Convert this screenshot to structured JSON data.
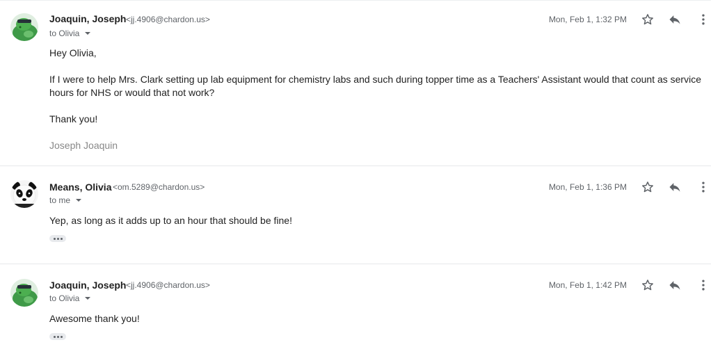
{
  "messages": [
    {
      "sender": "Joaquin, Joseph",
      "email": "<jj.4906@chardon.us>",
      "recipient": "to Olivia",
      "date": "Mon, Feb 1, 1:32 PM",
      "avatar_icon": "turtle-avatar-icon",
      "body": {
        "greeting": "Hey Olivia,",
        "paragraph": "If I were to help Mrs. Clark setting up lab equipment for chemistry labs and such during topper time as a Teachers' Assistant would that count as service hours for NHS or would that not work?",
        "closing": "Thank you!",
        "signature": "Joseph Joaquin"
      }
    },
    {
      "sender": "Means, Olivia",
      "email": "<om.5289@chardon.us>",
      "recipient": "to me",
      "date": "Mon, Feb 1, 1:36 PM",
      "avatar_icon": "panda-avatar-icon",
      "body": {
        "text": "Yep, as long as it adds up to an hour that should be fine!"
      }
    },
    {
      "sender": "Joaquin, Joseph",
      "email": "<jj.4906@chardon.us>",
      "recipient": "to Olivia",
      "date": "Mon, Feb 1, 1:42 PM",
      "avatar_icon": "turtle-avatar-icon",
      "body": {
        "text": "Awesome thank you!"
      }
    }
  ],
  "icons": {
    "star": "star-outline-icon",
    "reply": "reply-icon",
    "more": "more-vertical-icon",
    "expand": "show-trimmed-content-icon"
  },
  "colors": {
    "avatar_green": "#4caf50",
    "secondary_text": "#5f6368",
    "signature": "#888888",
    "divider": "#e6e8ea"
  }
}
